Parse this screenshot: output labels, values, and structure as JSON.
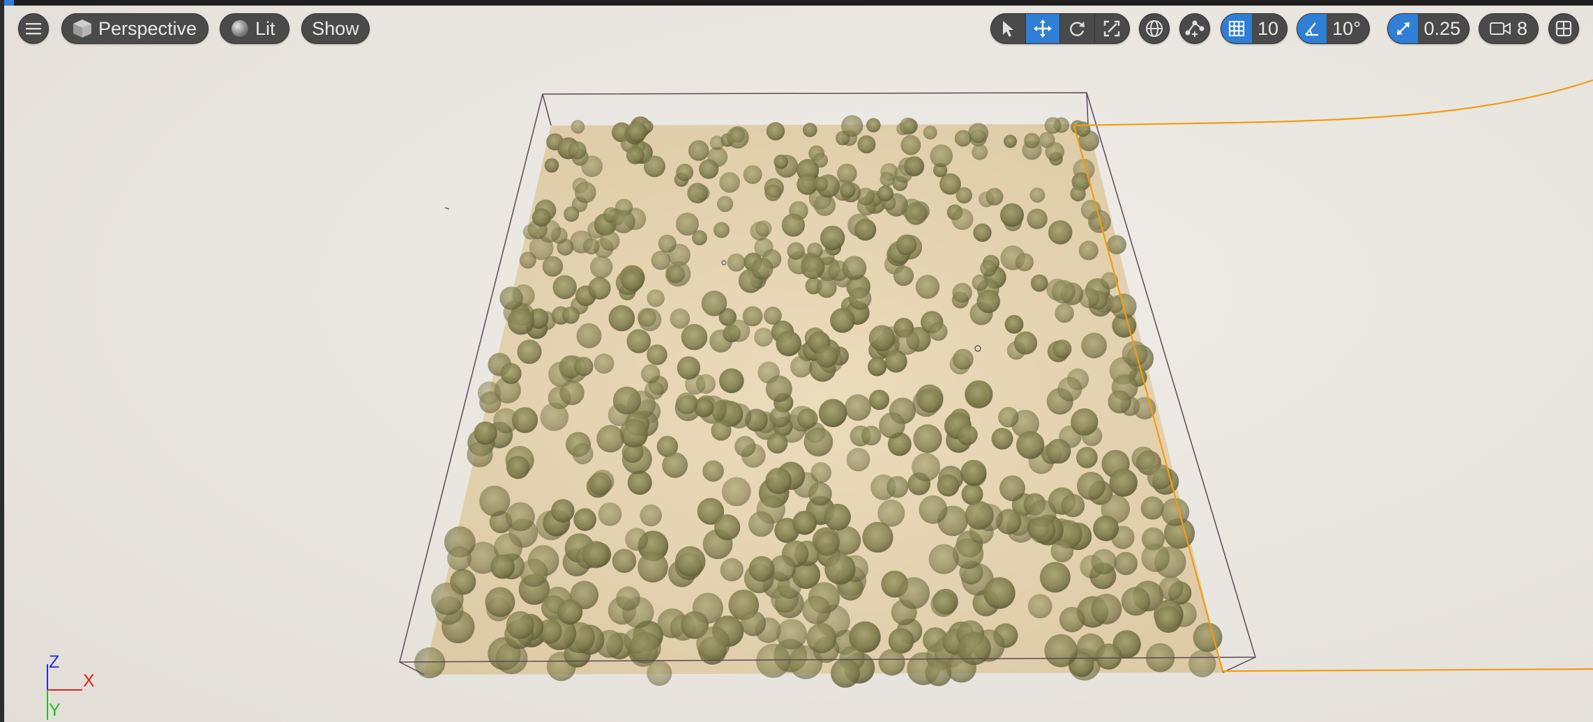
{
  "toolbar": {
    "menu_icon": "hamburger-menu-icon",
    "view_mode": {
      "icon": "cube-icon",
      "label": "Perspective"
    },
    "lighting": {
      "icon": "sphere-icon",
      "label": "Lit"
    },
    "show_label": "Show",
    "transform_tools": [
      "select-arrow-icon",
      "move-icon",
      "rotate-icon",
      "scale-icon"
    ],
    "active_tool": "move-icon",
    "coordinate_space_icon": "globe-icon",
    "surface_snap_icon": "surface-snap-icon",
    "grid_snap": {
      "icon": "grid-icon",
      "value": "10"
    },
    "rotation_snap": {
      "icon": "angle-icon",
      "value": "10°"
    },
    "scale_snap": {
      "icon": "scale-snap-icon",
      "value": "0.25"
    },
    "camera_speed": {
      "icon": "camera-icon",
      "value": "8"
    },
    "layout_icon": "viewport-layout-icon",
    "accent_color": "#2f7fd6"
  },
  "axis_gizmo": {
    "z": "Z",
    "x": "X",
    "y": "Y",
    "colors": {
      "x": "#e02020",
      "y": "#22c022",
      "z": "#2030e0"
    }
  },
  "scene": {
    "ground_color": "#e2d2b0",
    "tree_color": "#7f7b4c",
    "selection_color": "#f39c12",
    "bounds_color": "#5a4a55"
  }
}
